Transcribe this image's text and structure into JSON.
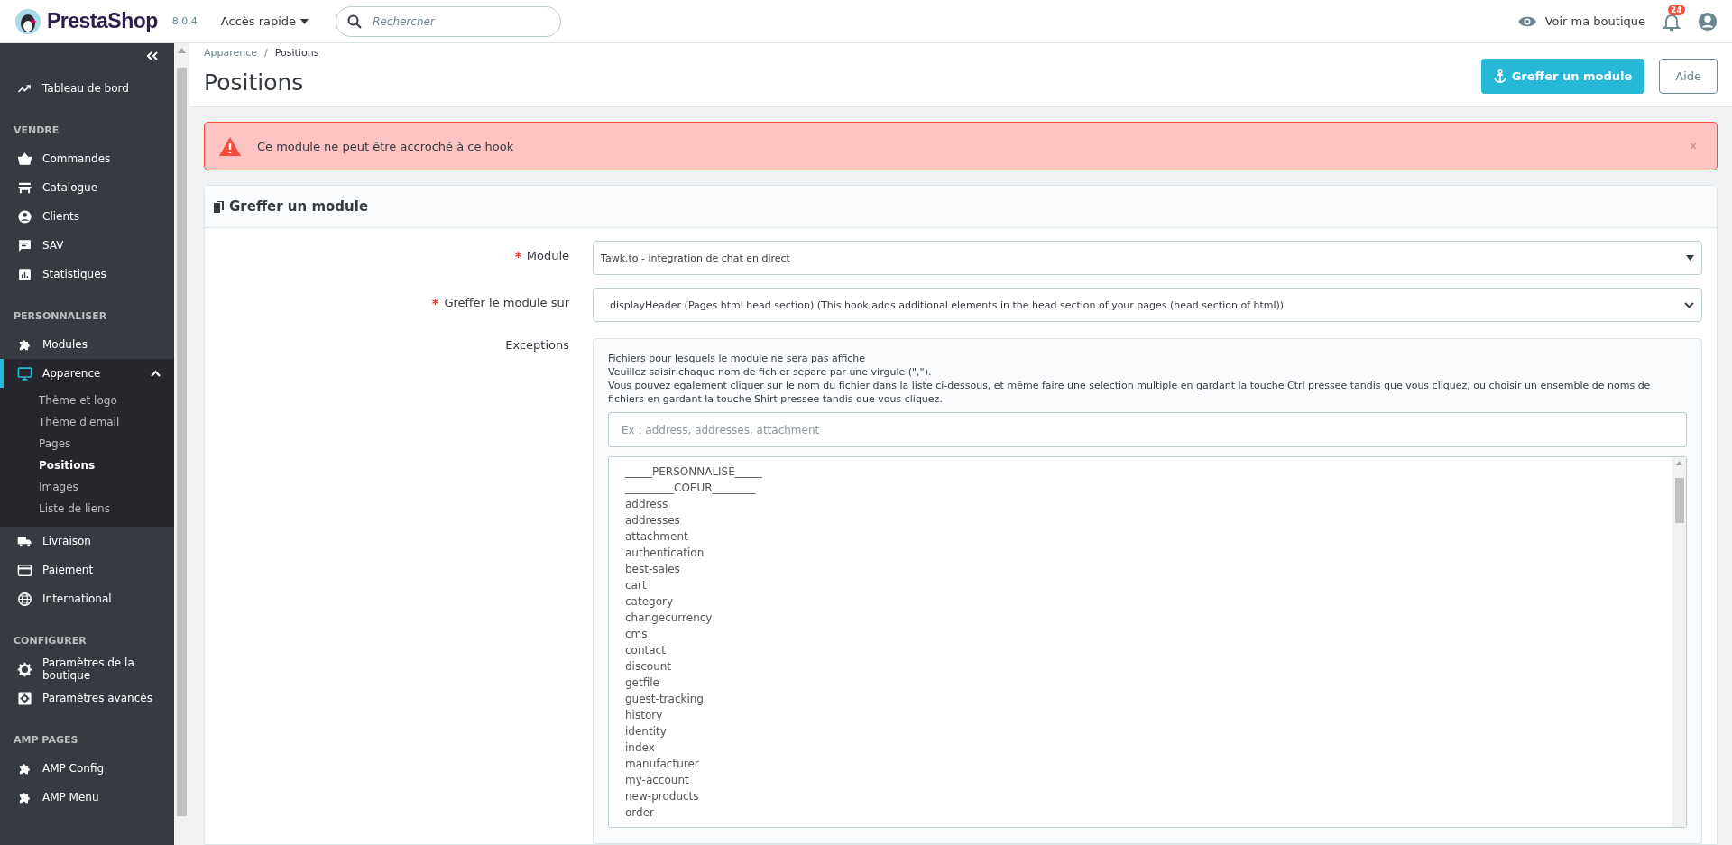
{
  "header": {
    "logo_text": "PrestaShop",
    "version": "8.0.4",
    "quick_access": "Accès rapide",
    "search": {
      "placeholder": "Rechercher"
    },
    "view_shop": "Voir ma boutique",
    "notifications_count": "24"
  },
  "sidebar": {
    "sections": [
      {
        "items": [
          {
            "label": "Tableau de bord",
            "selected": false,
            "expanded": false
          }
        ]
      },
      {
        "title": "VENDRE",
        "items": [
          {
            "label": "Commandes",
            "selected": false,
            "expanded": false
          },
          {
            "label": "Catalogue",
            "selected": false,
            "expanded": false
          },
          {
            "label": "Clients",
            "selected": false,
            "expanded": false
          },
          {
            "label": "SAV",
            "selected": false,
            "expanded": false
          },
          {
            "label": "Statistiques",
            "selected": false,
            "expanded": false
          }
        ]
      },
      {
        "title": "PERSONNALISER",
        "items": [
          {
            "label": "Modules",
            "selected": false,
            "expanded": false
          },
          {
            "label": "Apparence",
            "selected": true,
            "expanded": true,
            "children": [
              {
                "label": "Thème et logo",
                "selected": false
              },
              {
                "label": "Thème d'email",
                "selected": false
              },
              {
                "label": "Pages",
                "selected": false
              },
              {
                "label": "Positions",
                "selected": true
              },
              {
                "label": "Images",
                "selected": false
              },
              {
                "label": "Liste de liens",
                "selected": false
              }
            ]
          },
          {
            "label": "Livraison",
            "selected": false,
            "expanded": false
          },
          {
            "label": "Paiement",
            "selected": false,
            "expanded": false
          },
          {
            "label": "International",
            "selected": false,
            "expanded": false
          }
        ]
      },
      {
        "title": "CONFIGURER",
        "items": [
          {
            "label": "Paramètres de la boutique",
            "selected": false,
            "expanded": false
          },
          {
            "label": "Paramètres avancés",
            "selected": false,
            "expanded": false
          }
        ]
      },
      {
        "title": "AMP PAGES",
        "items": [
          {
            "label": "AMP Config",
            "selected": false,
            "expanded": false
          },
          {
            "label": "AMP Menu",
            "selected": false,
            "expanded": false
          }
        ]
      }
    ]
  },
  "breadcrumb": {
    "items": [
      "Apparence",
      "Positions"
    ],
    "separator": "/"
  },
  "page_title": "Positions",
  "toolbar": {
    "primary_button": "Greffer un module",
    "help_button": "Aide"
  },
  "alert": {
    "message": "Ce module ne peut être accroché à ce hook",
    "dismiss": "×"
  },
  "panel": {
    "title": "Greffer un module",
    "fields": [
      {
        "label": "Module",
        "required": true,
        "value": "Tawk.to - integration de chat en direct"
      },
      {
        "label": "Greffer le module sur",
        "required": true,
        "value": "displayHeader (Pages html head section) (This hook adds additional elements in the head section of your pages (head section of html))"
      }
    ],
    "exceptions": {
      "label": "Exceptions",
      "help": [
        "Fichiers pour lesquels le module ne sera pas affiche",
        "Veuillez saisir chaque nom de fichier separe par une virgule (\",\").",
        "Vous pouvez egalement cliquer sur le nom du fichier dans la liste ci-dessous, et même faire une selection multiple en gardant la touche Ctrl pressee tandis que vous cliquez, ou choisir un ensemble de noms de fichiers en gardant la touche Shirt pressee tandis que vous cliquez."
      ],
      "placeholder": "Ex : address, addresses, attachment",
      "options": [
        {
          "label": "_____PERSONNALISÉ_____",
          "selected": false
        },
        {
          "label": "_________COEUR________",
          "selected": false
        },
        {
          "label": "address",
          "selected": false
        },
        {
          "label": "addresses",
          "selected": false
        },
        {
          "label": "attachment",
          "selected": false
        },
        {
          "label": "authentication",
          "selected": false
        },
        {
          "label": "best-sales",
          "selected": false
        },
        {
          "label": "cart",
          "selected": false
        },
        {
          "label": "category",
          "selected": false
        },
        {
          "label": "changecurrency",
          "selected": false
        },
        {
          "label": "cms",
          "selected": false
        },
        {
          "label": "contact",
          "selected": false
        },
        {
          "label": "discount",
          "selected": false
        },
        {
          "label": "getfile",
          "selected": false
        },
        {
          "label": "guest-tracking",
          "selected": false
        },
        {
          "label": "history",
          "selected": false
        },
        {
          "label": "identity",
          "selected": false
        },
        {
          "label": "index",
          "selected": false
        },
        {
          "label": "manufacturer",
          "selected": false
        },
        {
          "label": "my-account",
          "selected": false
        },
        {
          "label": "new-products",
          "selected": false
        },
        {
          "label": "order",
          "selected": false
        }
      ]
    }
  }
}
